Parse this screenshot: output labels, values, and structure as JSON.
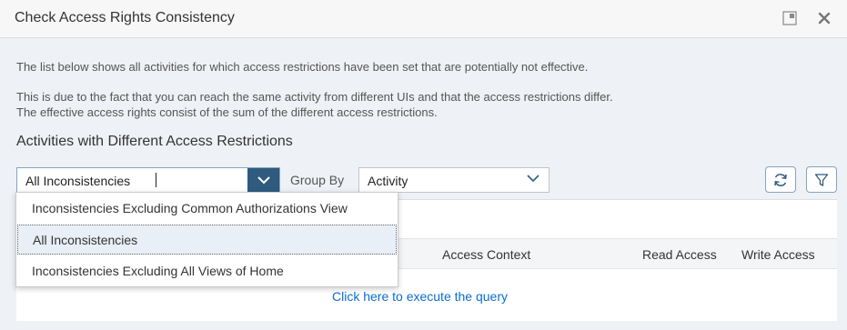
{
  "dialog": {
    "title": "Check Access Rights Consistency"
  },
  "content": {
    "info_line1": "The list below shows all activities for which access restrictions have been set that are potentially not effective.",
    "info_line2": "This is due to the fact that you can reach the same activity from different UIs and that the access restrictions differ.",
    "info_line3": "The effective access rights consist of the sum of the different access restrictions.",
    "section_title": "Activities with Different Access Restrictions"
  },
  "filter": {
    "selected": "All Inconsistencies",
    "group_by_label": "Group By",
    "group_by_value": "Activity"
  },
  "dropdown": {
    "options": [
      "Inconsistencies Excluding Common Authorizations View",
      "All Inconsistencies",
      "Inconsistencies Excluding All Views of Home"
    ]
  },
  "table": {
    "columns": {
      "access_context": "Access Context",
      "read_access": "Read Access",
      "write_access": "Write Access"
    },
    "execute_link": "Click here to execute the query"
  },
  "icons": {
    "restore": "restore-window-icon",
    "close": "close-icon",
    "dropdown": "chevron-down-icon",
    "refresh": "refresh-icon",
    "filter": "filter-icon"
  },
  "colors": {
    "accent": "#2f5b7e",
    "link": "#0a6ed1",
    "background": "#eef1f5"
  }
}
